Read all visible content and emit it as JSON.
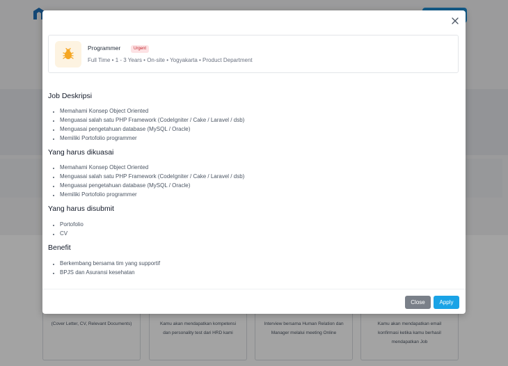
{
  "background": {
    "cards": [
      {
        "text": "(Cover Letter, CV, Relevant Documents)"
      },
      {
        "text": "Kamu akan mendapatkan kompetensi dan personality test dari HRD kami"
      },
      {
        "text": "Interview bersama Human Relation dan Manager melalui meeting Online"
      },
      {
        "text": "Kamu akan mendapatkan email konfirmasi ketika kamu berhasil mendapatkan Job"
      }
    ]
  },
  "modal": {
    "job": {
      "title": "Programmer",
      "badge": "Urgent",
      "meta": "Full Time • 1 - 3 Years • On-site • Yogyakarta • Product Department",
      "icon": "bug-icon"
    },
    "sections": [
      {
        "heading": "Job Deskripsi",
        "items": [
          "Memahami Konsep Object Oriented",
          "Menguasai salah satu PHP Framework (CodeIgniter / Cake / Laravel / dsb)",
          "Menguasai pengetahuan database (MySQL / Oracle)",
          "Memiliki Portofolio programmer"
        ]
      },
      {
        "heading": "Yang harus dikuasai",
        "items": [
          "Memahami Konsep Object Oriented",
          "Menguasai salah satu PHP Framework (CodeIgniter / Cake / Laravel / dsb)",
          "Menguasai pengetahuan database (MySQL / Oracle)",
          "Memiliki Portofolio programmer"
        ]
      },
      {
        "heading": "Yang harus disubmit",
        "items": [
          "Portofolio",
          "CV"
        ]
      },
      {
        "heading": "Benefit",
        "items": [
          "Berkembang bersama tim yang supportif",
          "BPJS dan Asuransi kesehatan"
        ]
      }
    ],
    "buttons": {
      "close_label": "Close",
      "apply_label": "Apply"
    }
  },
  "colors": {
    "apply": "#1aa3e6",
    "close": "#7a8089",
    "badge_bg": "#fde2e4",
    "badge_text": "#c0262d",
    "icon_accent": "#f5a623"
  }
}
